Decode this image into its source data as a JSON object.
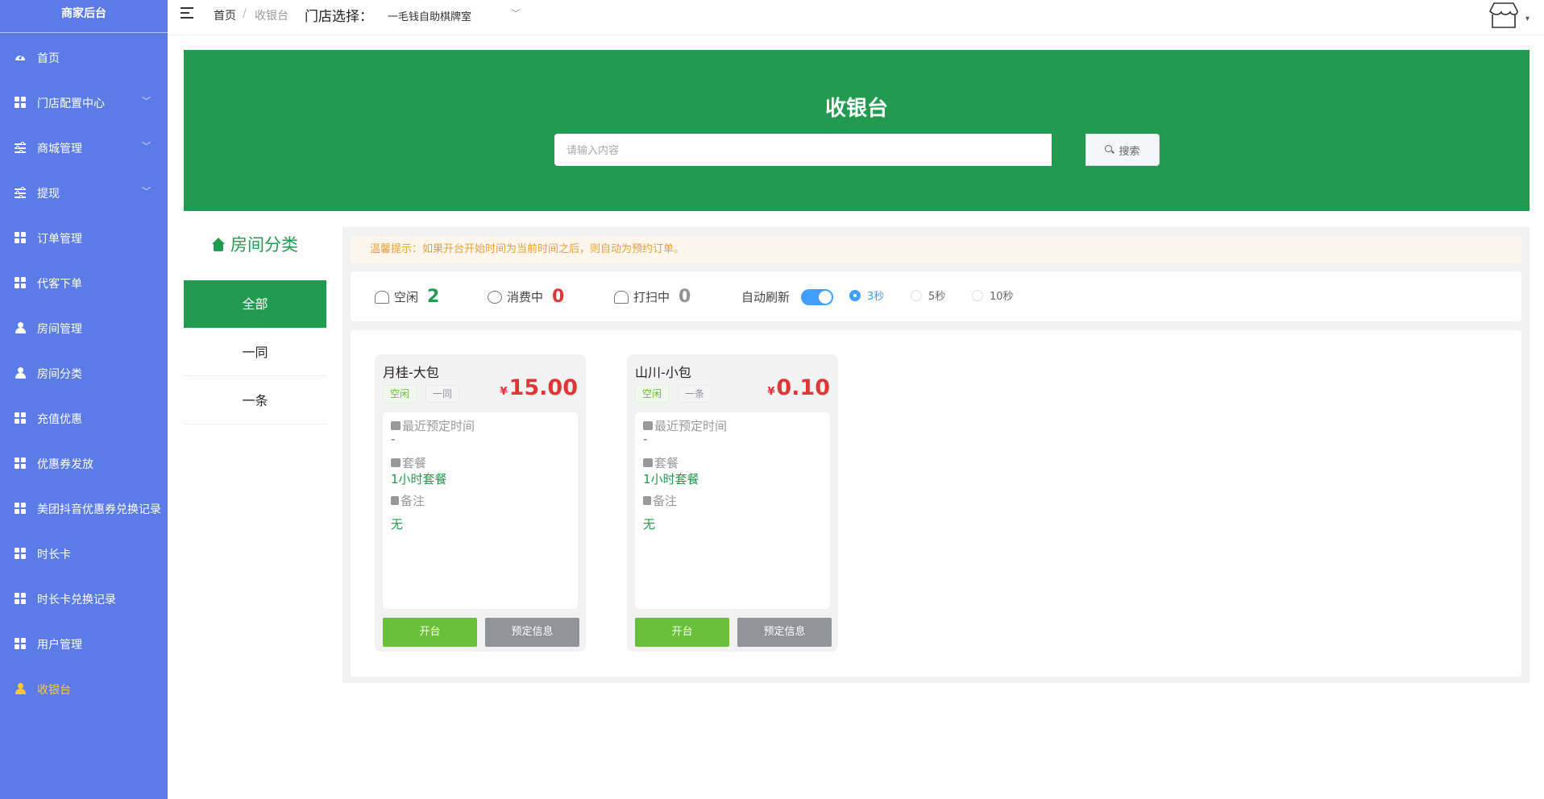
{
  "sidebar": {
    "brand": "商家后台",
    "items": [
      {
        "label": "首页",
        "icon": "dashboard-icon"
      },
      {
        "label": "门店配置中心",
        "icon": "grid-icon",
        "chevron": "﹀"
      },
      {
        "label": "商城管理",
        "icon": "sliders-icon",
        "chevron": "﹀"
      },
      {
        "label": "提现",
        "icon": "sliders-icon",
        "chevron": "﹀"
      },
      {
        "label": "订单管理",
        "icon": "grid-icon"
      },
      {
        "label": "代客下单",
        "icon": "grid-icon"
      },
      {
        "label": "房间管理",
        "icon": "user-icon"
      },
      {
        "label": "房间分类",
        "icon": "user-icon"
      },
      {
        "label": "充值优惠",
        "icon": "grid-icon"
      },
      {
        "label": "优惠券发放",
        "icon": "grid-icon"
      },
      {
        "label": "美团抖音优惠券兑换记录",
        "icon": "grid-icon"
      },
      {
        "label": "时长卡",
        "icon": "grid-icon"
      },
      {
        "label": "时长卡兑换记录",
        "icon": "grid-icon"
      },
      {
        "label": "用户管理",
        "icon": "grid-icon"
      },
      {
        "label": "收银台",
        "icon": "user-icon",
        "active": true
      }
    ]
  },
  "header": {
    "breadcrumb_home": "首页",
    "breadcrumb_sep": "/",
    "breadcrumb_current": "收银台",
    "store_label": "门店选择：",
    "store_value": "一毛钱自助棋牌室",
    "store_chevron": "﹀",
    "avatar_caret": "▾"
  },
  "hero": {
    "title": "收银台",
    "search_placeholder": "请输入内容",
    "search_button": "搜索"
  },
  "categories": {
    "title": "房间分类",
    "items": [
      "全部",
      "一同",
      "一条"
    ]
  },
  "tip": "温馨提示：如果开台开始时间为当前时间之后，则自动为预约订单。",
  "status": {
    "free_label": "空闲",
    "free_count": "2",
    "busy_label": "消费中",
    "busy_count": "0",
    "clean_label": "打扫中",
    "clean_count": "0",
    "auto_refresh_label": "自动刷新",
    "auto_refresh_on": true,
    "intervals": [
      "3秒",
      "5秒",
      "10秒"
    ],
    "selected_interval": "3秒"
  },
  "rooms": [
    {
      "name": "月桂-大包",
      "status_tag": "空闲",
      "category_tag": "一同",
      "currency": "¥",
      "price": "15.00",
      "recent_label": "最近预定时间",
      "recent_value": "-",
      "package_label": "套餐",
      "package_value": "1小时套餐",
      "remark_label": "备注",
      "remark_value": "无",
      "open_button": "开台",
      "info_button": "预定信息"
    },
    {
      "name": "山川-小包",
      "status_tag": "空闲",
      "category_tag": "一条",
      "currency": "¥",
      "price": "0.10",
      "recent_label": "最近预定时间",
      "recent_value": "-",
      "package_label": "套餐",
      "package_value": "1小时套餐",
      "remark_label": "备注",
      "remark_value": "无",
      "open_button": "开台",
      "info_button": "预定信息"
    }
  ],
  "colors": {
    "sidebar": "#5b7ce6",
    "sidebar_active": "#ffc935",
    "hero": "#229a4f",
    "free": "#229a4f",
    "busy": "#e03636",
    "clean": "#909399",
    "switch_on": "#409eff",
    "open_button": "#67c23a",
    "info_button": "#909399"
  }
}
